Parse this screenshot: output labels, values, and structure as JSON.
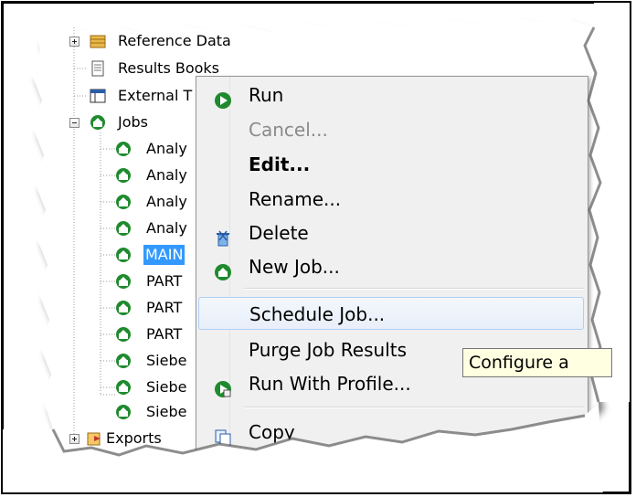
{
  "tree": {
    "items": [
      {
        "label": "Reference Data",
        "icon": "folder-table-icon"
      },
      {
        "label": "Results Books",
        "icon": "results-book-icon"
      },
      {
        "label": "External T",
        "icon": "external-table-icon"
      },
      {
        "label": "Jobs",
        "icon": "job-icon"
      },
      {
        "label": "Analy",
        "icon": "job-icon"
      },
      {
        "label": "Analy",
        "icon": "job-icon"
      },
      {
        "label": "Analy",
        "icon": "job-icon"
      },
      {
        "label": "Analy",
        "icon": "job-icon"
      },
      {
        "label": "MAIN",
        "icon": "job-icon",
        "selected": true
      },
      {
        "label": "PART",
        "icon": "job-icon"
      },
      {
        "label": "PART",
        "icon": "job-icon"
      },
      {
        "label": "PART",
        "icon": "job-icon"
      },
      {
        "label": "Siebe",
        "icon": "job-icon"
      },
      {
        "label": "Siebe",
        "icon": "job-icon"
      },
      {
        "label": "Siebe",
        "icon": "job-icon"
      },
      {
        "label": "Exports",
        "icon": "exports-icon"
      }
    ]
  },
  "context_menu": {
    "items": [
      {
        "label": "Run",
        "icon": "run-icon",
        "state": "normal"
      },
      {
        "label": "Cancel...",
        "icon": "",
        "state": "disabled"
      },
      {
        "label": "Edit...",
        "icon": "",
        "state": "bold"
      },
      {
        "label": "Rename...",
        "icon": "",
        "state": "normal"
      },
      {
        "label": "Delete",
        "icon": "delete-icon",
        "state": "normal"
      },
      {
        "label": "New Job...",
        "icon": "new-job-icon",
        "state": "normal"
      },
      {
        "label": "Schedule Job...",
        "icon": "",
        "state": "hover"
      },
      {
        "label": "Purge Job Results",
        "icon": "",
        "state": "normal"
      },
      {
        "label": "Run With Profile...",
        "icon": "run-profile-icon",
        "state": "normal"
      },
      {
        "label": "Copy",
        "icon": "copy-icon",
        "state": "normal"
      }
    ]
  },
  "tooltip": {
    "text": "Configure a"
  },
  "colors": {
    "selection": "#3399ff",
    "job_icon_green": "#1f8a2e",
    "menu_bg": "#f0f0f0",
    "tooltip_bg": "#ffffe1"
  }
}
